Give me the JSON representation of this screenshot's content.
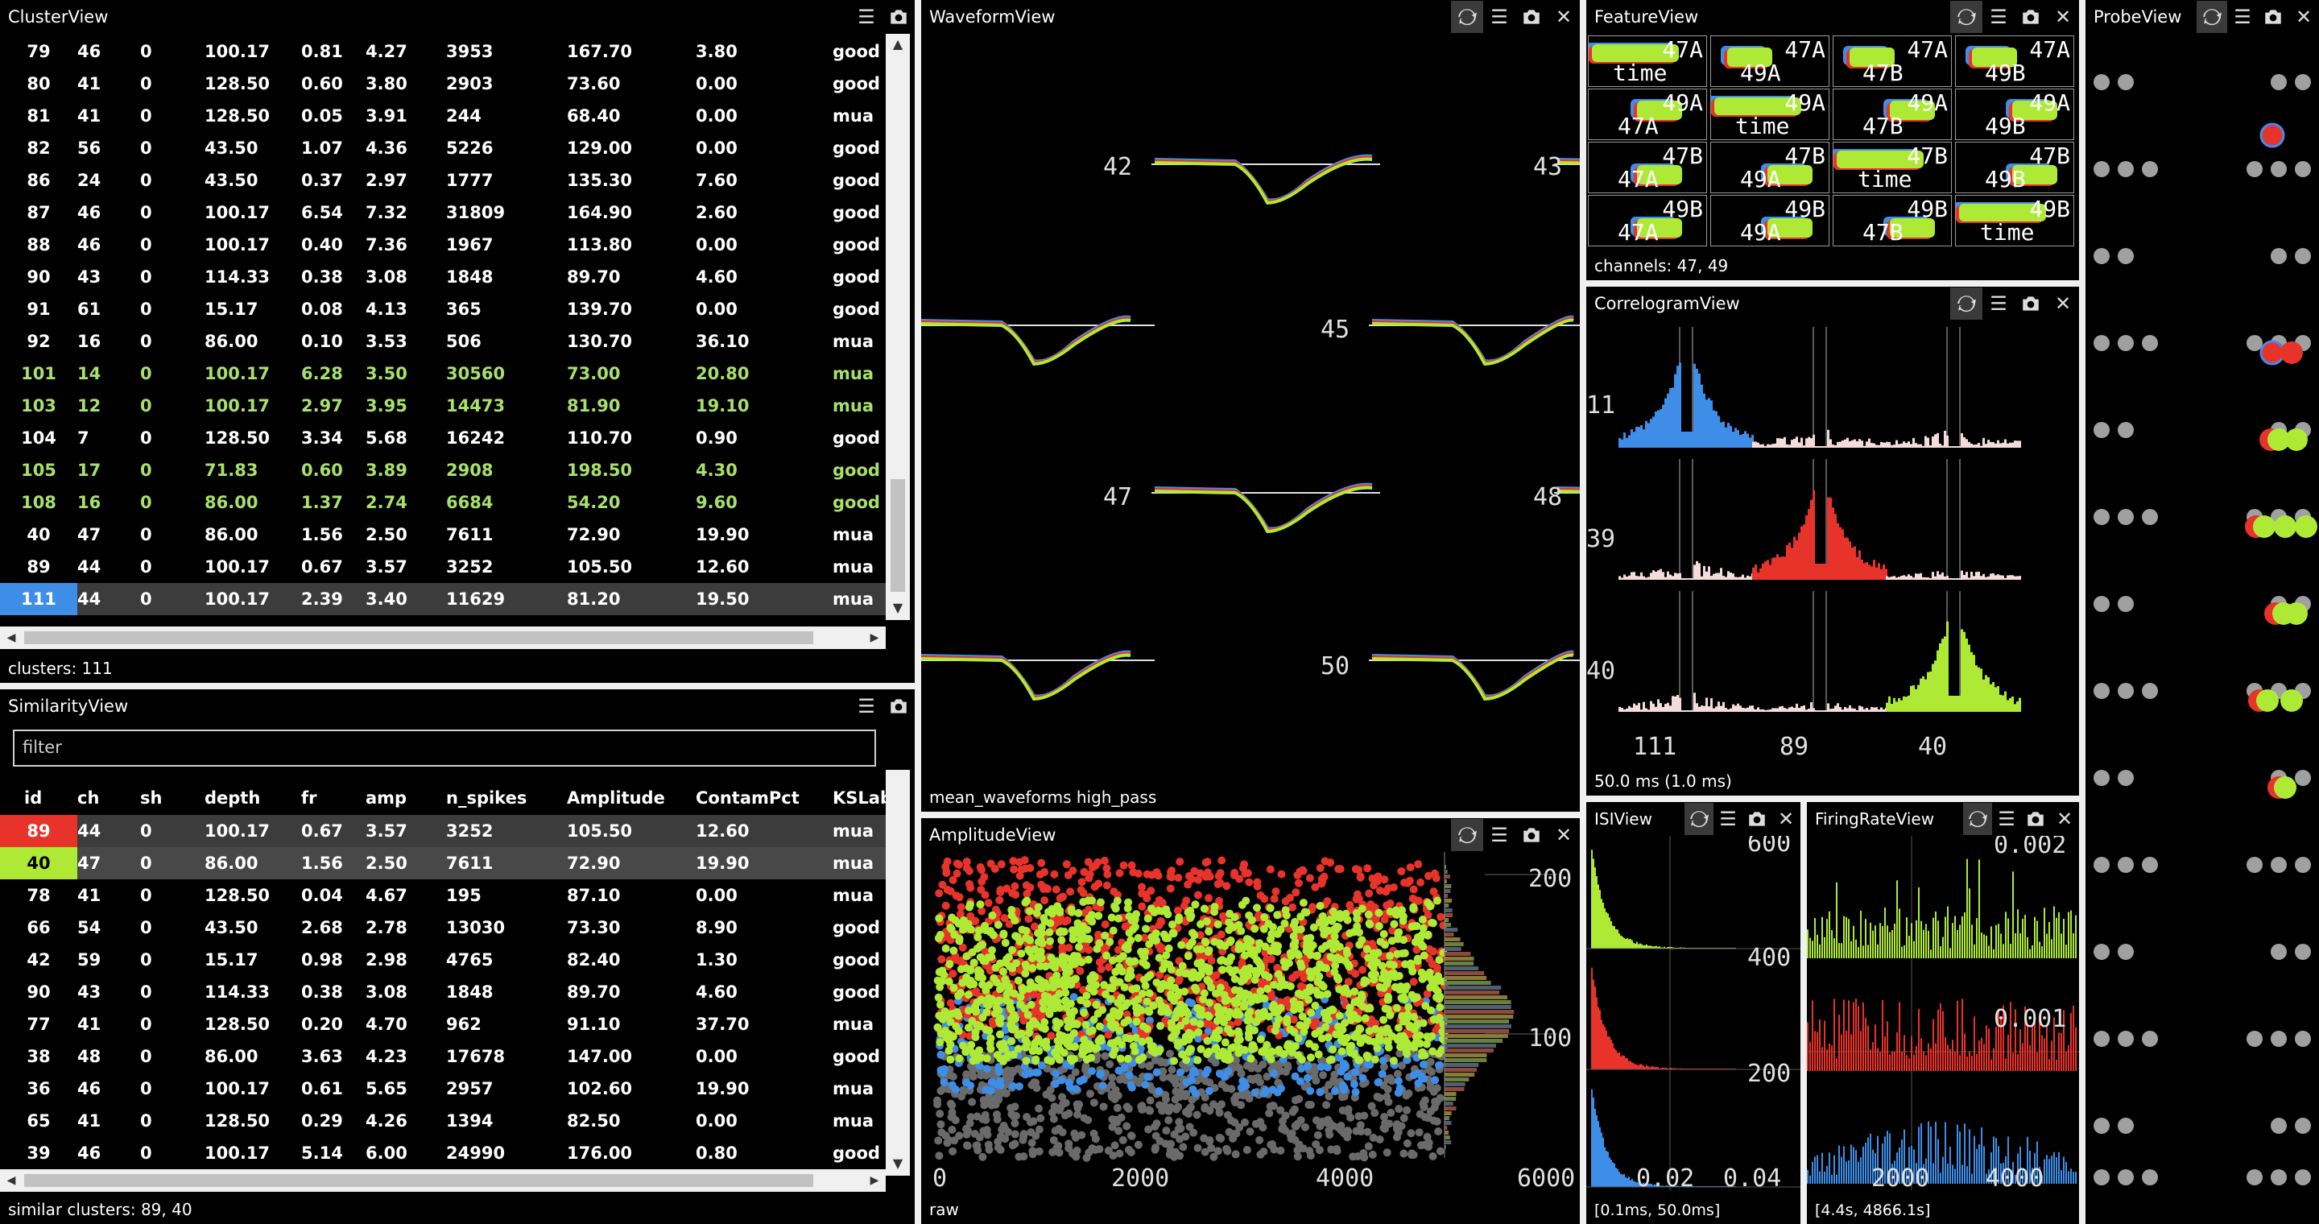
{
  "colors": {
    "blue": "#3e8ee8",
    "red": "#e8332a",
    "green": "#aeea35",
    "lightgreen": "#a8e06c",
    "grey": "#808080"
  },
  "cluster_view": {
    "title": "ClusterView",
    "footer": "clusters: 111",
    "rows": [
      {
        "id": "79",
        "ch": "46",
        "sh": "0",
        "depth": "100.17",
        "fr": "0.81",
        "amp": "4.27",
        "n_spikes": "3953",
        "amplitude": "167.70",
        "contam": "3.80",
        "label": "good",
        "style": "good"
      },
      {
        "id": "80",
        "ch": "41",
        "sh": "0",
        "depth": "128.50",
        "fr": "0.60",
        "amp": "3.80",
        "n_spikes": "2903",
        "amplitude": "73.60",
        "contam": "0.00",
        "label": "good",
        "style": "good"
      },
      {
        "id": "81",
        "ch": "41",
        "sh": "0",
        "depth": "128.50",
        "fr": "0.05",
        "amp": "3.91",
        "n_spikes": "244",
        "amplitude": "68.40",
        "contam": "0.00",
        "label": "mua",
        "style": "mua"
      },
      {
        "id": "82",
        "ch": "56",
        "sh": "0",
        "depth": "43.50",
        "fr": "1.07",
        "amp": "4.36",
        "n_spikes": "5226",
        "amplitude": "129.00",
        "contam": "0.00",
        "label": "good",
        "style": "good"
      },
      {
        "id": "86",
        "ch": "24",
        "sh": "0",
        "depth": "43.50",
        "fr": "0.37",
        "amp": "2.97",
        "n_spikes": "1777",
        "amplitude": "135.30",
        "contam": "7.60",
        "label": "good",
        "style": "good"
      },
      {
        "id": "87",
        "ch": "46",
        "sh": "0",
        "depth": "100.17",
        "fr": "6.54",
        "amp": "7.32",
        "n_spikes": "31809",
        "amplitude": "164.90",
        "contam": "2.60",
        "label": "good",
        "style": "good"
      },
      {
        "id": "88",
        "ch": "46",
        "sh": "0",
        "depth": "100.17",
        "fr": "0.40",
        "amp": "7.36",
        "n_spikes": "1967",
        "amplitude": "113.80",
        "contam": "0.00",
        "label": "good",
        "style": "good"
      },
      {
        "id": "90",
        "ch": "43",
        "sh": "0",
        "depth": "114.33",
        "fr": "0.38",
        "amp": "3.08",
        "n_spikes": "1848",
        "amplitude": "89.70",
        "contam": "4.60",
        "label": "good",
        "style": "good"
      },
      {
        "id": "91",
        "ch": "61",
        "sh": "0",
        "depth": "15.17",
        "fr": "0.08",
        "amp": "4.13",
        "n_spikes": "365",
        "amplitude": "139.70",
        "contam": "0.00",
        "label": "good",
        "style": "good"
      },
      {
        "id": "92",
        "ch": "16",
        "sh": "0",
        "depth": "86.00",
        "fr": "0.10",
        "amp": "3.53",
        "n_spikes": "506",
        "amplitude": "130.70",
        "contam": "36.10",
        "label": "mua",
        "style": "mua"
      },
      {
        "id": "101",
        "ch": "14",
        "sh": "0",
        "depth": "100.17",
        "fr": "6.28",
        "amp": "3.50",
        "n_spikes": "30560",
        "amplitude": "73.00",
        "contam": "20.80",
        "label": "mua",
        "style": "lg"
      },
      {
        "id": "103",
        "ch": "12",
        "sh": "0",
        "depth": "100.17",
        "fr": "2.97",
        "amp": "3.95",
        "n_spikes": "14473",
        "amplitude": "81.90",
        "contam": "19.10",
        "label": "mua",
        "style": "lg"
      },
      {
        "id": "104",
        "ch": "7",
        "sh": "0",
        "depth": "128.50",
        "fr": "3.34",
        "amp": "5.68",
        "n_spikes": "16242",
        "amplitude": "110.70",
        "contam": "0.90",
        "label": "good",
        "style": "good"
      },
      {
        "id": "105",
        "ch": "17",
        "sh": "0",
        "depth": "71.83",
        "fr": "0.60",
        "amp": "3.89",
        "n_spikes": "2908",
        "amplitude": "198.50",
        "contam": "4.30",
        "label": "good",
        "style": "lg"
      },
      {
        "id": "108",
        "ch": "16",
        "sh": "0",
        "depth": "86.00",
        "fr": "1.37",
        "amp": "2.74",
        "n_spikes": "6684",
        "amplitude": "54.20",
        "contam": "9.60",
        "label": "good",
        "style": "lg"
      },
      {
        "id": "40",
        "ch": "47",
        "sh": "0",
        "depth": "86.00",
        "fr": "1.56",
        "amp": "2.50",
        "n_spikes": "7611",
        "amplitude": "72.90",
        "contam": "19.90",
        "label": "mua",
        "style": "good"
      },
      {
        "id": "89",
        "ch": "44",
        "sh": "0",
        "depth": "100.17",
        "fr": "0.67",
        "amp": "3.57",
        "n_spikes": "3252",
        "amplitude": "105.50",
        "contam": "12.60",
        "label": "mua",
        "style": "good"
      },
      {
        "id": "111",
        "ch": "44",
        "sh": "0",
        "depth": "100.17",
        "fr": "2.39",
        "amp": "3.40",
        "n_spikes": "11629",
        "amplitude": "81.20",
        "contam": "19.50",
        "label": "mua",
        "style": "sel",
        "idcolor": "#3e8ee8"
      }
    ]
  },
  "similarity_view": {
    "title": "SimilarityView",
    "filter_placeholder": "filter",
    "footer": "similar clusters: 89, 40",
    "headers": [
      "id",
      "ch",
      "sh",
      "depth",
      "fr",
      "amp",
      "n_spikes",
      "Amplitude",
      "ContamPct",
      "KSLab"
    ],
    "rows": [
      {
        "id": "89",
        "ch": "44",
        "sh": "0",
        "depth": "100.17",
        "fr": "0.67",
        "amp": "3.57",
        "n_spikes": "3252",
        "amplitude": "105.50",
        "contam": "12.60",
        "label": "mua",
        "style": "sel",
        "idcolor": "#e8332a"
      },
      {
        "id": "40",
        "ch": "47",
        "sh": "0",
        "depth": "86.00",
        "fr": "1.56",
        "amp": "2.50",
        "n_spikes": "7611",
        "amplitude": "72.90",
        "contam": "19.90",
        "label": "mua",
        "style": "sel2",
        "idcolor": "#aeea35"
      },
      {
        "id": "78",
        "ch": "41",
        "sh": "0",
        "depth": "128.50",
        "fr": "0.04",
        "amp": "4.67",
        "n_spikes": "195",
        "amplitude": "87.10",
        "contam": "0.00",
        "label": "mua",
        "style": "good"
      },
      {
        "id": "66",
        "ch": "54",
        "sh": "0",
        "depth": "43.50",
        "fr": "2.68",
        "amp": "2.78",
        "n_spikes": "13030",
        "amplitude": "73.30",
        "contam": "8.90",
        "label": "good",
        "style": "good"
      },
      {
        "id": "42",
        "ch": "59",
        "sh": "0",
        "depth": "15.17",
        "fr": "0.98",
        "amp": "2.98",
        "n_spikes": "4765",
        "amplitude": "82.40",
        "contam": "1.30",
        "label": "good",
        "style": "good"
      },
      {
        "id": "90",
        "ch": "43",
        "sh": "0",
        "depth": "114.33",
        "fr": "0.38",
        "amp": "3.08",
        "n_spikes": "1848",
        "amplitude": "89.70",
        "contam": "4.60",
        "label": "good",
        "style": "good"
      },
      {
        "id": "77",
        "ch": "41",
        "sh": "0",
        "depth": "128.50",
        "fr": "0.20",
        "amp": "4.70",
        "n_spikes": "962",
        "amplitude": "91.10",
        "contam": "37.70",
        "label": "mua",
        "style": "good"
      },
      {
        "id": "38",
        "ch": "48",
        "sh": "0",
        "depth": "86.00",
        "fr": "3.63",
        "amp": "4.23",
        "n_spikes": "17678",
        "amplitude": "147.00",
        "contam": "0.00",
        "label": "good",
        "style": "good"
      },
      {
        "id": "36",
        "ch": "46",
        "sh": "0",
        "depth": "100.17",
        "fr": "0.61",
        "amp": "5.65",
        "n_spikes": "2957",
        "amplitude": "102.60",
        "contam": "19.90",
        "label": "mua",
        "style": "good"
      },
      {
        "id": "65",
        "ch": "41",
        "sh": "0",
        "depth": "128.50",
        "fr": "0.29",
        "amp": "4.26",
        "n_spikes": "1394",
        "amplitude": "82.50",
        "contam": "0.00",
        "label": "mua",
        "style": "good"
      },
      {
        "id": "39",
        "ch": "46",
        "sh": "0",
        "depth": "100.17",
        "fr": "5.14",
        "amp": "6.00",
        "n_spikes": "24990",
        "amplitude": "176.00",
        "contam": "0.80",
        "label": "good",
        "style": "good"
      }
    ]
  },
  "waveform_view": {
    "title": "WaveformView",
    "footer": "mean_waveforms high_pass",
    "channels": [
      {
        "label": "42",
        "col": "right"
      },
      {
        "label": "43",
        "col": "edge"
      },
      {
        "label": "45",
        "col": "edge"
      },
      {
        "label": "47",
        "col": "right"
      },
      {
        "label": "48",
        "col": "edge"
      },
      {
        "label": "50",
        "col": "edge"
      }
    ]
  },
  "feature_view": {
    "title": "FeatureView",
    "footer": "channels: 47, 49",
    "grid": [
      [
        [
          "47A",
          "time"
        ],
        [
          "47A",
          "49A"
        ],
        [
          "47A",
          "47B"
        ],
        [
          "47A",
          "49B"
        ]
      ],
      [
        [
          "49A",
          "47A"
        ],
        [
          "49A",
          "time"
        ],
        [
          "49A",
          "47B"
        ],
        [
          "49A",
          "49B"
        ]
      ],
      [
        [
          "47B",
          "47A"
        ],
        [
          "47B",
          "49A"
        ],
        [
          "47B",
          "time"
        ],
        [
          "47B",
          "49B"
        ]
      ],
      [
        [
          "49B",
          "47A"
        ],
        [
          "49B",
          "49A"
        ],
        [
          "49B",
          "47B"
        ],
        [
          "49B",
          "time"
        ]
      ]
    ]
  },
  "correlogram_view": {
    "title": "CorrelogramView",
    "footer": "50.0 ms (1.0 ms)",
    "x_labels": [
      "111",
      "89",
      "40"
    ],
    "y_labels": [
      "11",
      "39",
      "40"
    ]
  },
  "amplitude_view": {
    "title": "AmplitudeView",
    "footer": "raw",
    "x_ticks": [
      "0",
      "2000",
      "4000",
      "6000"
    ],
    "y_ticks": [
      "200",
      "100"
    ]
  },
  "isi_view": {
    "title": "ISIView",
    "footer": "[0.1ms, 50.0ms]",
    "y_ticks": [
      "600",
      "400",
      "200"
    ],
    "x_ticks": [
      "0.02",
      "0.04"
    ]
  },
  "firing_rate_view": {
    "title": "FiringRateView",
    "footer": "[4.4s, 4866.1s]",
    "y_ticks": [
      "0.002",
      "0.001"
    ],
    "x_ticks": [
      "2000",
      "4000"
    ]
  },
  "probe_view": {
    "title": "ProbeView"
  }
}
